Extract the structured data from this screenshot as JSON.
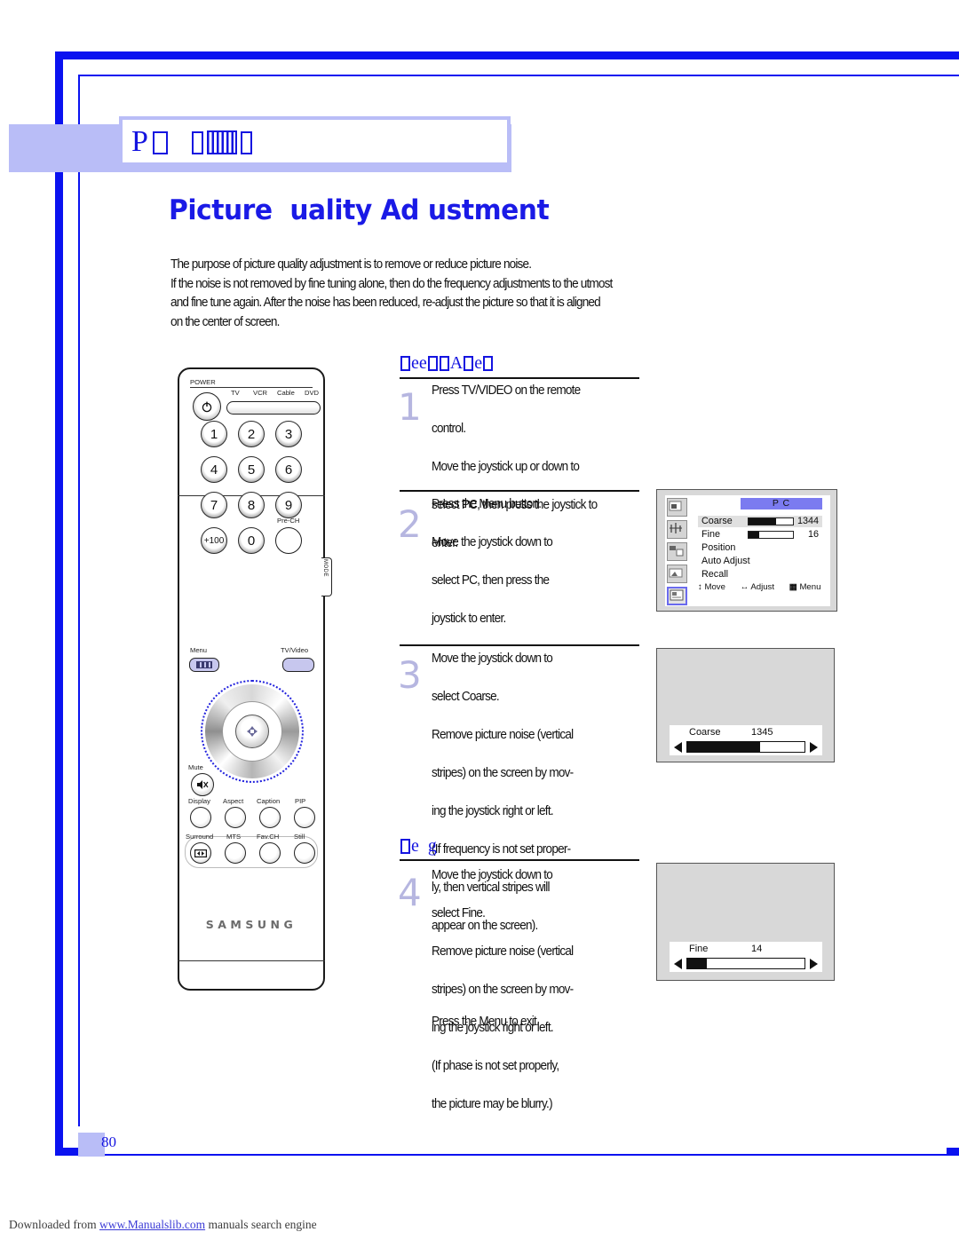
{
  "header": {
    "prefix": "P",
    "tofu_note": "missing-glyph boxes",
    "label_text": "P"
  },
  "title": "Picture  uality Ad ustment",
  "intro": [
    "The purpose of picture quality adjustment is to remove or reduce picture noise.",
    "If the noise is not removed by fine tuning alone, then do the frequency adjustments to the utmost",
    "and fine tune again.  After the noise has been reduced, re-adjust the picture so that it is aligned",
    "on the center of screen."
  ],
  "sections": {
    "coarse_heading": "   A  ",
    "fine_heading": "  "
  },
  "steps": [
    {
      "number": "1",
      "lines": [
        "Press TV/VIDEO on the remote",
        "control.",
        "Move the joystick up or down to",
        "select PC, then press the joystick to",
        "enter."
      ]
    },
    {
      "number": "2",
      "lines": [
        "Press the Menu button.",
        "Move the joystick down to",
        "select PC, then press the",
        "joystick to enter."
      ]
    },
    {
      "number": "3",
      "lines": [
        "Move the joystick down to",
        "select Coarse.",
        "Remove picture noise (vertical",
        "stripes) on the screen by mov-",
        "ing the joystick right or left.",
        "(If frequency is not set proper-",
        "ly, then vertical stripes will",
        "appear on the screen)."
      ]
    },
    {
      "number": "4",
      "lines": [
        "Move the joystick down to",
        "select Fine.",
        "Remove picture noise (vertical",
        "stripes) on the screen by mov-",
        "ing the joystick right or left.",
        "(If phase is not set properly,",
        "the picture may be blurry.)"
      ]
    }
  ],
  "closing_line": "Press the Menu to exit.",
  "osd": {
    "title": "P    C",
    "rows": [
      {
        "label": "Coarse",
        "value": "1344",
        "bar_pct": 62,
        "highlighted": true
      },
      {
        "label": "Fine",
        "value": "16",
        "bar_pct": 24,
        "highlighted": false
      },
      {
        "label": "Position",
        "value": "",
        "bar_pct": null,
        "highlighted": false
      },
      {
        "label": "Auto Adjust",
        "value": "",
        "bar_pct": null,
        "highlighted": false
      },
      {
        "label": "Recall",
        "value": "",
        "bar_pct": null,
        "highlighted": false
      }
    ],
    "footer": {
      "move": "Move",
      "adjust": "Adjust",
      "menu": "Menu",
      "move_icon": "up-down-arrow-icon",
      "adjust_icon": "left-right-arrow-icon",
      "menu_icon": "menu-bars-icon"
    },
    "sidebar_icons": [
      "picture-icon",
      "sound-icon",
      "channel-icon",
      "setup-icon",
      "pc-icon"
    ],
    "selected_sidebar_index": 4
  },
  "coarse_screen": {
    "label": "Coarse",
    "value": "1345",
    "bar_pct": 62,
    "left_arrow": "left-triangle-icon",
    "right_arrow": "right-triangle-icon"
  },
  "fine_screen": {
    "label": "Fine",
    "value": "14",
    "bar_pct": 17,
    "left_arrow": "left-triangle-icon",
    "right_arrow": "right-triangle-icon"
  },
  "remote": {
    "power_label": "POWER",
    "power_icon": "power-icon",
    "mode_labels": [
      "TV",
      "VCR",
      "Cable",
      "DVD"
    ],
    "mode_tab_label": "MODE",
    "keys": [
      "1",
      "2",
      "3",
      "4",
      "5",
      "6",
      "7",
      "8",
      "9",
      "+100",
      "0"
    ],
    "prech_label": "Pre-CH",
    "menu_label": "Menu",
    "tvvideo_label": "TV/Video",
    "mute_label": "Mute",
    "mute_icon": "mute-speaker-icon",
    "row_labels_1": [
      "Display",
      "Aspect",
      "Caption",
      "PIP"
    ],
    "row_labels_2": [
      "Surround",
      "MTS",
      "Fav.CH",
      "Still"
    ],
    "surround_icon": "surround-sound-icon",
    "brand": "SAMSUNG",
    "joystick_icon": "joystick-enter-icon"
  },
  "page_number": "80",
  "footer": {
    "before": "Downloaded from ",
    "link": "www.Manualslib.com",
    "after": " manuals search engine"
  },
  "colors": {
    "brand_blue": "#1414e0",
    "frame_blue": "#0a12f0",
    "lavender": "#b9bdf7",
    "osd_title_bar": "#7b7bf0",
    "step_number": "#b6b6e0"
  }
}
